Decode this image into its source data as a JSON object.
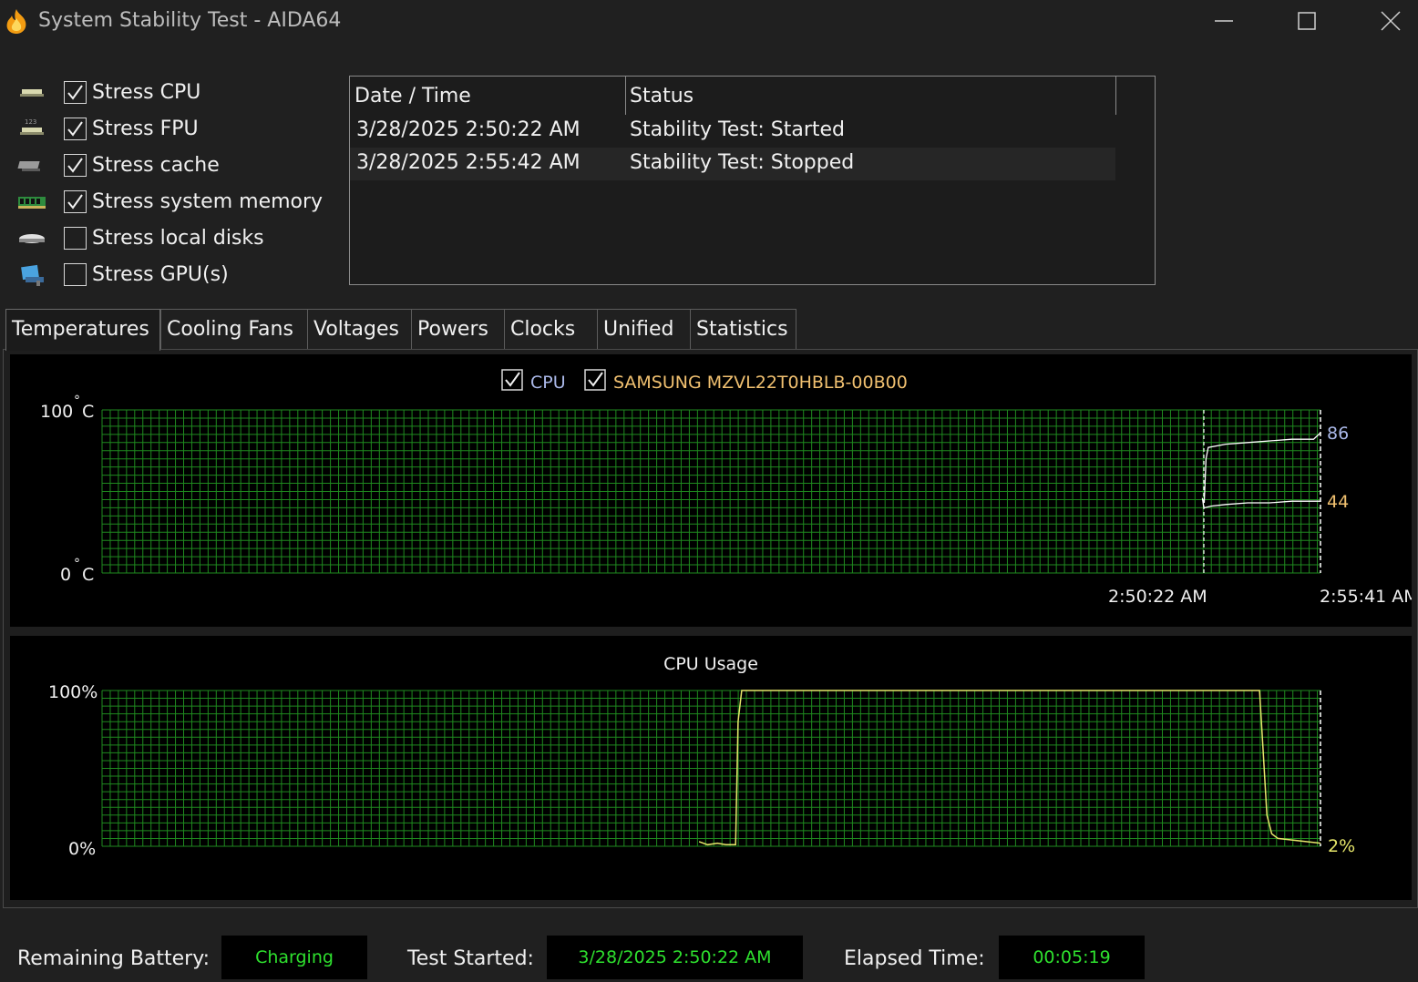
{
  "window": {
    "title": "System Stability Test - AIDA64",
    "icon": "flame-icon"
  },
  "stress_options": [
    {
      "label": "Stress CPU",
      "checked": true,
      "icon": "cpu-chip-icon"
    },
    {
      "label": "Stress FPU",
      "checked": true,
      "icon": "fpu-chip-icon"
    },
    {
      "label": "Stress cache",
      "checked": true,
      "icon": "cache-chip-icon"
    },
    {
      "label": "Stress system memory",
      "checked": true,
      "icon": "memory-module-icon"
    },
    {
      "label": "Stress local disks",
      "checked": false,
      "icon": "disk-icon"
    },
    {
      "label": "Stress GPU(s)",
      "checked": false,
      "icon": "gpu-icon"
    }
  ],
  "log": {
    "columns": [
      "Date / Time",
      "Status"
    ],
    "rows": [
      [
        "3/28/2025 2:50:22 AM",
        "Stability Test: Started"
      ],
      [
        "3/28/2025 2:55:42 AM",
        "Stability Test: Stopped"
      ]
    ]
  },
  "tabs": [
    "Temperatures",
    "Cooling Fans",
    "Voltages",
    "Powers",
    "Clocks",
    "Unified",
    "Statistics"
  ],
  "active_tab": "Temperatures",
  "colors": {
    "grid": "#1f8a1f",
    "cpu_series": "#aab8e8",
    "ssd_series": "#f0c070",
    "usage_series": "#e6e66a",
    "status_green": "#2ee02e"
  },
  "chart_data": [
    {
      "type": "line",
      "title": "",
      "legend": [
        {
          "name": "CPU",
          "checked": true,
          "color": "#aab8e8"
        },
        {
          "name": "SAMSUNG MZVL22T0HBLB-00B00",
          "checked": true,
          "color": "#f0c070"
        }
      ],
      "ylabel_top": "100",
      "ylabel_bottom": "0",
      "yunit": "C",
      "ylim": [
        0,
        100
      ],
      "xlim": [
        "2:50:22 AM",
        "2:55:41 AM"
      ],
      "x_labels": [
        "2:50:22 AM",
        "2:55:41 AM"
      ],
      "grid": true,
      "series": [
        {
          "name": "CPU",
          "current_label": "86",
          "x": [
            0,
            1,
            6,
            12,
            60,
            120,
            180,
            240,
            300,
            319
          ],
          "y": [
            44,
            43,
            70,
            77,
            79,
            80,
            81,
            82,
            82,
            86
          ]
        },
        {
          "name": "SAMSUNG MZVL22T0HBLB-00B00",
          "current_label": "44",
          "x": [
            -4,
            0,
            2,
            20,
            60,
            120,
            180,
            240,
            300,
            319
          ],
          "y": [
            46,
            40,
            40,
            41,
            42,
            43,
            43,
            44,
            44,
            44
          ]
        }
      ]
    },
    {
      "type": "line",
      "title": "CPU Usage",
      "ylabel_top": "100%",
      "ylabel_bottom": "0%",
      "ylim": [
        0,
        100
      ],
      "grid": true,
      "series": [
        {
          "name": "CPU Usage",
          "current_label": "2%",
          "x": [
            0.49,
            0.497,
            0.505,
            0.512,
            0.52,
            0.522,
            0.525,
            0.95,
            0.953,
            0.956,
            0.96,
            0.965,
            1.0
          ],
          "y": [
            3,
            1,
            2,
            1,
            1,
            80,
            100,
            100,
            60,
            20,
            8,
            5,
            2
          ]
        }
      ]
    }
  ],
  "status": {
    "battery_label": "Remaining Battery:",
    "battery_value": "Charging",
    "started_label": "Test Started:",
    "started_value": "3/28/2025 2:50:22 AM",
    "elapsed_label": "Elapsed Time:",
    "elapsed_value": "00:05:19"
  }
}
